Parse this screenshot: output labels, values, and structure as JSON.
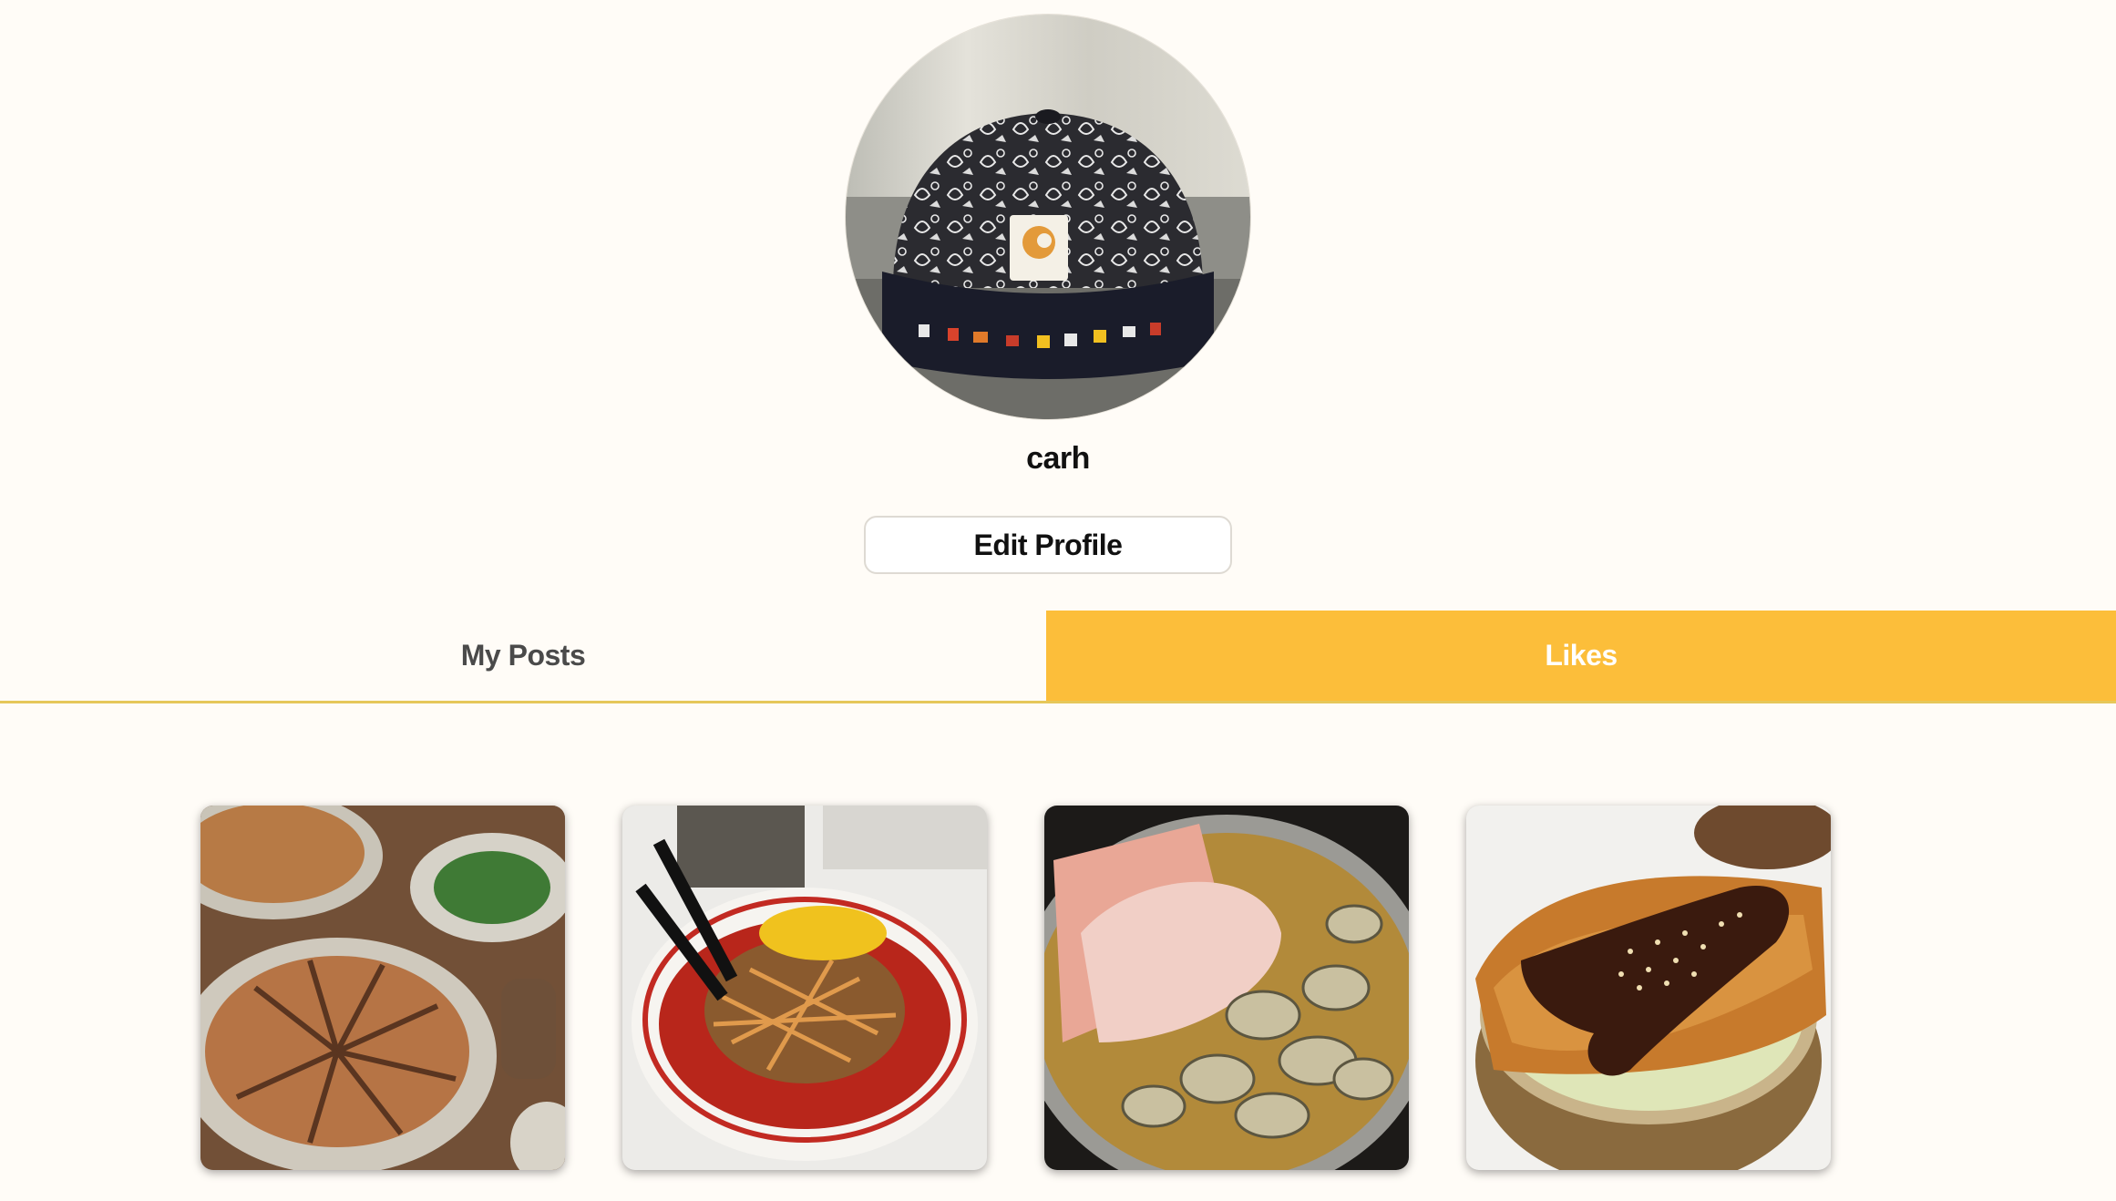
{
  "profile": {
    "username": "carh",
    "edit_label": "Edit Profile"
  },
  "tabs": [
    {
      "label": "My Posts",
      "active": false
    },
    {
      "label": "Likes",
      "active": true
    }
  ],
  "colors": {
    "background": "#fffcf7",
    "accent": "#fcbe3a",
    "tab_underline": "#e6c75a"
  },
  "liked_posts": [
    {
      "icon": "gyoza-photo"
    },
    {
      "icon": "spicy-ramen-photo"
    },
    {
      "icon": "oyster-hotpot-photo"
    },
    {
      "icon": "katsu-don-photo"
    }
  ]
}
